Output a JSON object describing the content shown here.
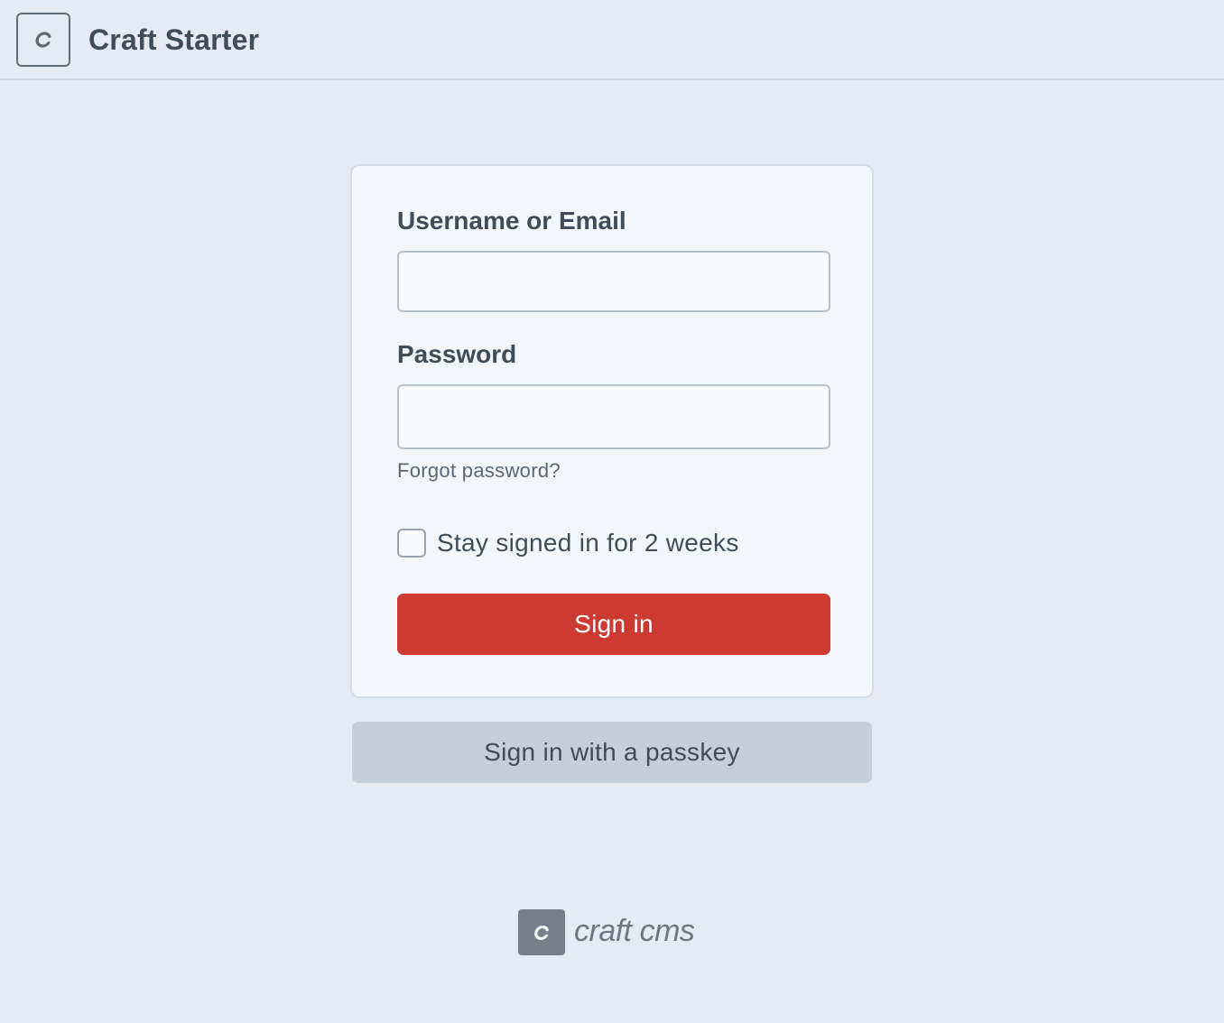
{
  "header": {
    "logo_icon": "craft-c-logo-icon",
    "site_name": "Craft Starter"
  },
  "login_form": {
    "username_label": "Username or Email",
    "username_value": "",
    "password_label": "Password",
    "password_value": "",
    "forgot_password": "Forgot password?",
    "remember_label": "Stay signed in for 2 weeks",
    "remember_checked": false,
    "submit_label": "Sign in"
  },
  "passkey_button": {
    "label": "Sign in with a passkey"
  },
  "footer": {
    "logo_icon": "craft-cms-logo-icon",
    "wordmark": "craft cms"
  },
  "colors": {
    "background": "#e4ebf5",
    "card": "#f3f7fc",
    "primary_button": "#cc3a31",
    "secondary_button": "#c5cedb",
    "text": "#3f4d5a"
  }
}
